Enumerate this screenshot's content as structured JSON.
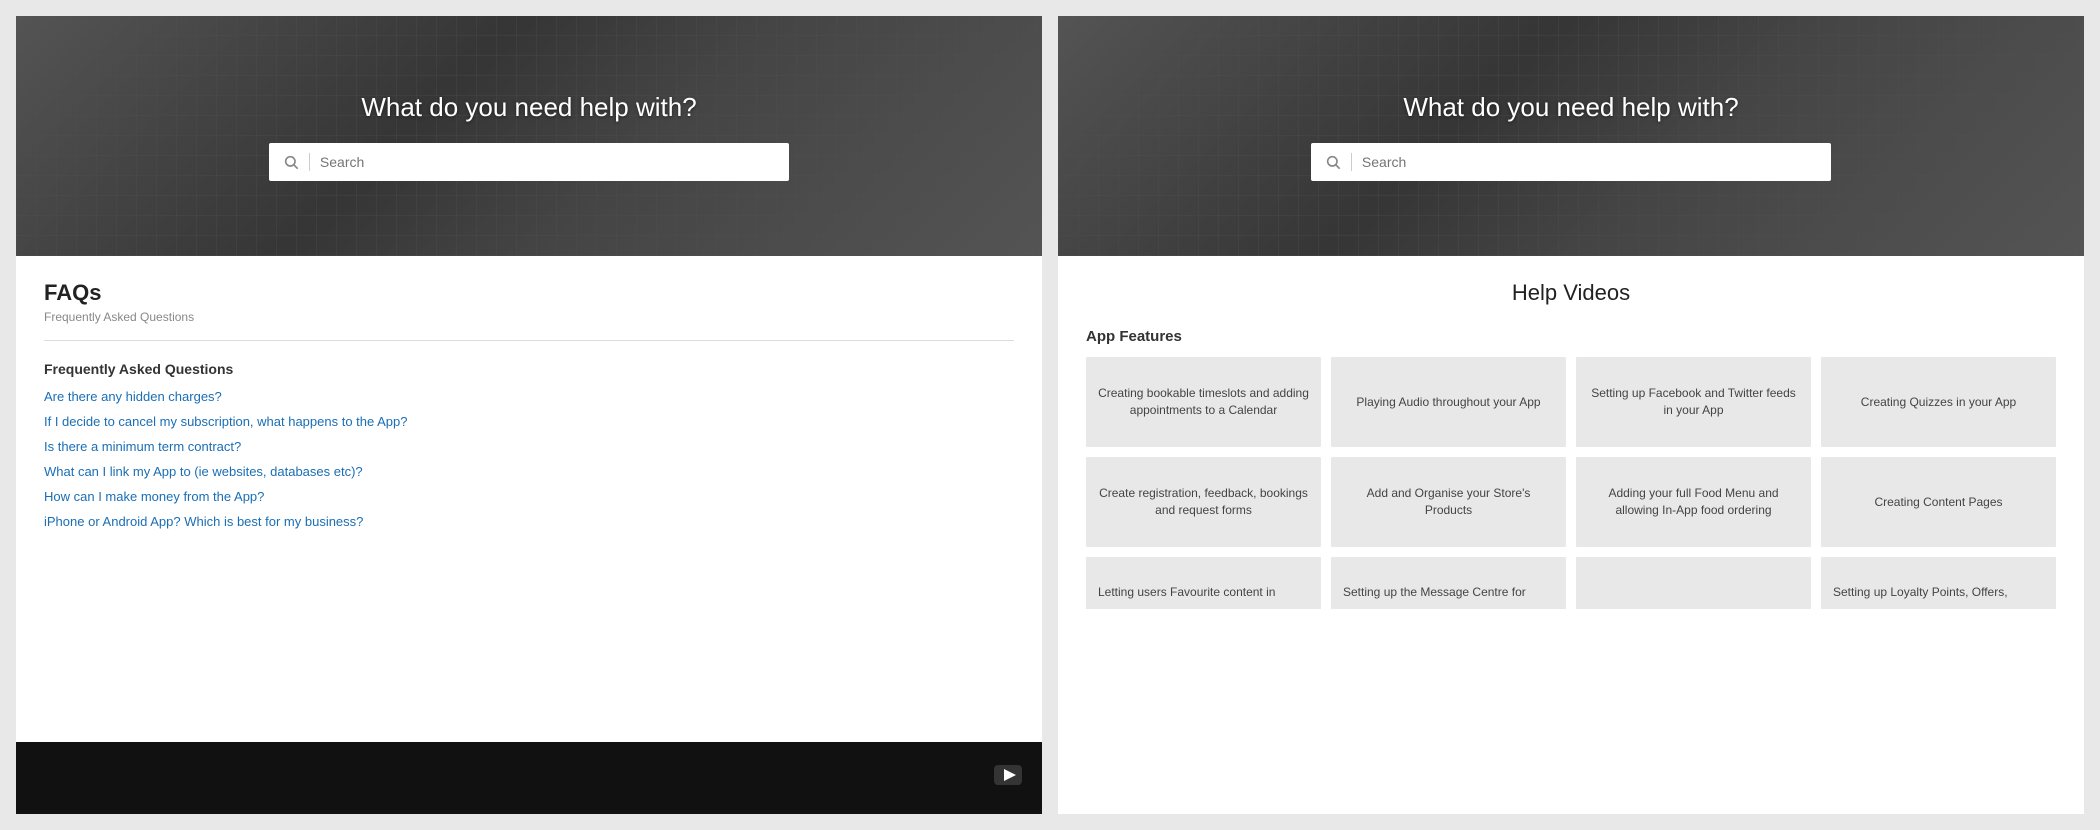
{
  "left_panel": {
    "hero": {
      "title": "What do you need help with?",
      "search_placeholder": "Search"
    },
    "faqs": {
      "title": "FAQs",
      "subtitle": "Frequently Asked Questions",
      "section_title": "Frequently Asked Questions",
      "links": [
        "Are there any hidden charges?",
        "If I decide to cancel my subscription, what happens to the App?",
        "Is there a minimum term contract?",
        "What can I link my App to (ie websites, databases etc)?",
        "How can I make money from the App?",
        "iPhone or Android App? Which is best for my business?"
      ]
    }
  },
  "right_panel": {
    "hero": {
      "title": "What do you need help with?",
      "search_placeholder": "Search"
    },
    "help_videos": {
      "title": "Help Videos",
      "section_heading": "App Features",
      "row1": [
        "Creating bookable timeslots and adding appointments to a Calendar",
        "Playing Audio throughout your App",
        "Setting up Facebook and Twitter feeds in your App",
        "Creating Quizzes in your App"
      ],
      "row2": [
        "Create registration, feedback, bookings and request forms",
        "Add and Organise your Store's Products",
        "Adding your full Food Menu and allowing In-App food ordering",
        "Creating Content Pages"
      ],
      "row3_partial": [
        "Letting users Favourite content in",
        "Setting up the Message Centre for",
        "",
        "Setting up Loyalty Points, Offers,"
      ]
    }
  },
  "icons": {
    "search": "🔍",
    "youtube": "▶"
  }
}
